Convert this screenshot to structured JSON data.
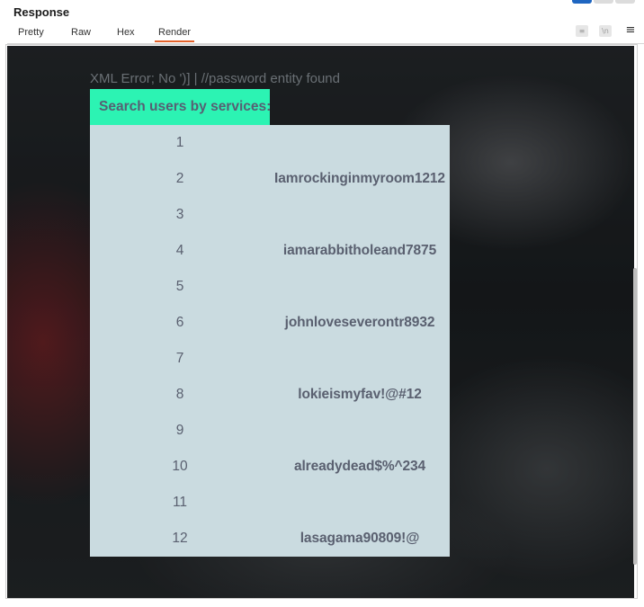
{
  "panel": {
    "title": "Response",
    "tabs": [
      {
        "label": "Pretty"
      },
      {
        "label": "Raw"
      },
      {
        "label": "Hex"
      },
      {
        "label": "Render"
      }
    ],
    "active_tab": "Render",
    "accent_color": "#e3622b",
    "toolbar_icons": [
      "wrap-lines-icon",
      "newline-icon",
      "menu-icon"
    ]
  },
  "page": {
    "error_text": "XML Error; No ')] | //password entity found",
    "search_header": "Search users by services:",
    "header_color": "#2cf3b3",
    "table_color": "#cadbe0",
    "rows": [
      {
        "num": "1",
        "value": ""
      },
      {
        "num": "2",
        "value": "Iamrockinginmyroom1212"
      },
      {
        "num": "3",
        "value": ""
      },
      {
        "num": "4",
        "value": "iamarabbitholeand7875"
      },
      {
        "num": "5",
        "value": ""
      },
      {
        "num": "6",
        "value": "johnloveseverontr8932"
      },
      {
        "num": "7",
        "value": ""
      },
      {
        "num": "8",
        "value": "lokieismyfav!@#12"
      },
      {
        "num": "9",
        "value": ""
      },
      {
        "num": "10",
        "value": "alreadydead$%^234"
      },
      {
        "num": "11",
        "value": ""
      },
      {
        "num": "12",
        "value": "lasagama90809!@"
      }
    ]
  }
}
